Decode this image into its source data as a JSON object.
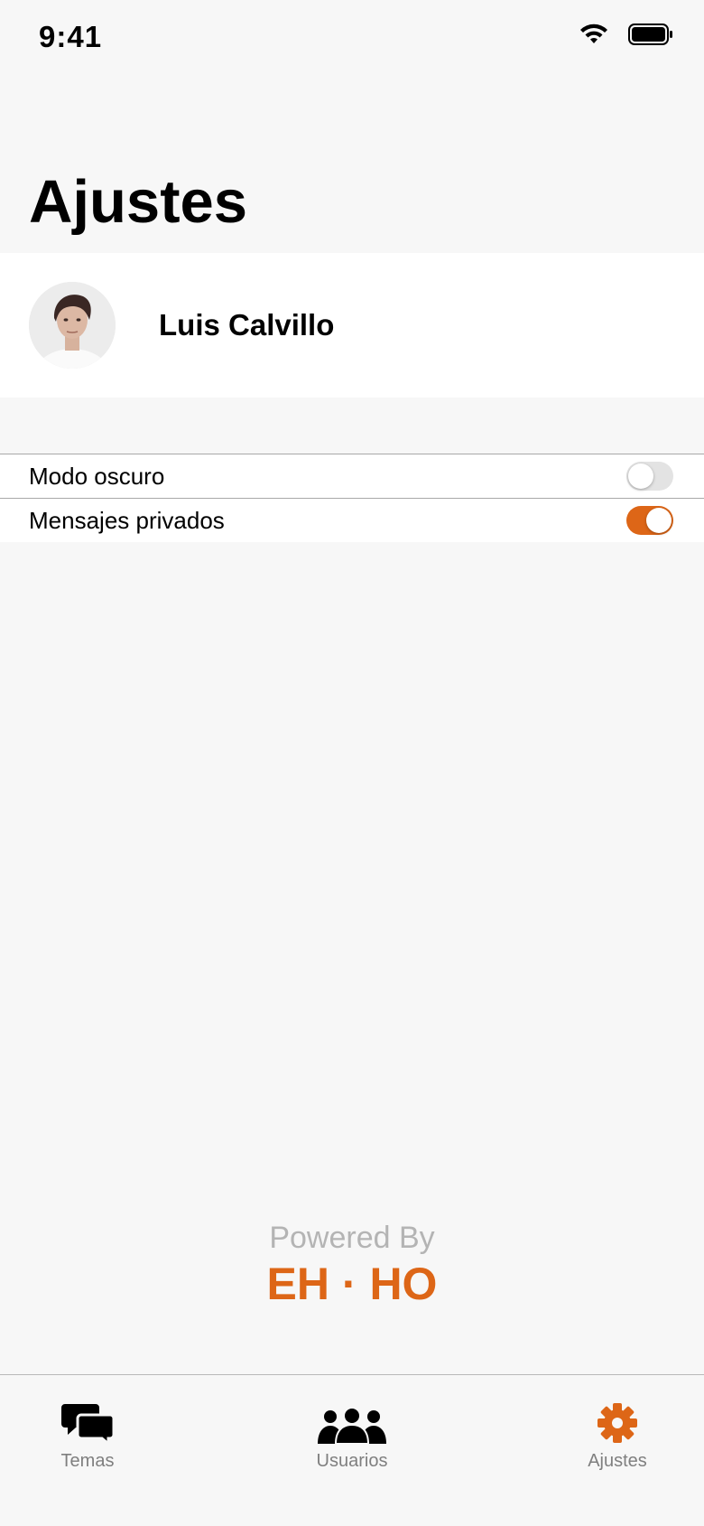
{
  "status_bar": {
    "time": "9:41",
    "icons": [
      "wifi-icon",
      "battery-icon"
    ]
  },
  "header": {
    "title": "Ajustes"
  },
  "profile": {
    "name": "Luis Calvillo",
    "avatar": "avatar-photo"
  },
  "settings": [
    {
      "label": "Modo oscuro",
      "enabled": false
    },
    {
      "label": "Mensajes privados",
      "enabled": true
    }
  ],
  "footer": {
    "powered_by": "Powered By",
    "brand": "EH · HO"
  },
  "tab_bar": {
    "tabs": [
      {
        "label": "Temas",
        "icon": "chat-bubbles-icon",
        "active": false
      },
      {
        "label": "Usuarios",
        "icon": "users-icon",
        "active": false
      },
      {
        "label": "Ajustes",
        "icon": "gear-icon",
        "active": true
      }
    ]
  },
  "colors": {
    "accent": "#dd6617",
    "background": "#f7f7f7",
    "inactive_tab": "#7f7f7f"
  }
}
